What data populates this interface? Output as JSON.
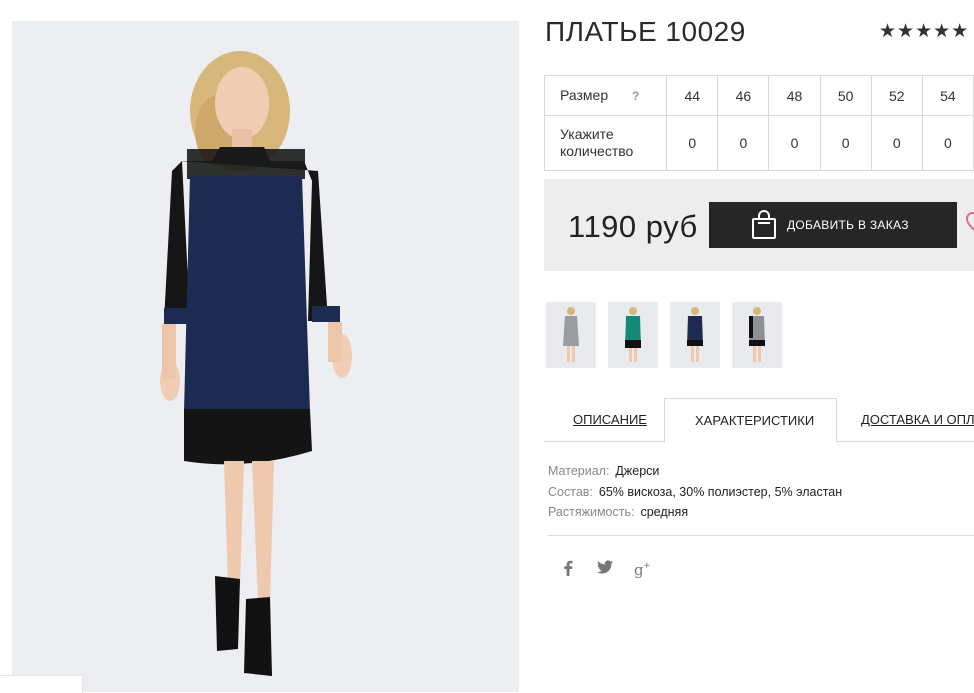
{
  "product": {
    "title": "ПЛАТЬЕ 10029",
    "rating": "★★★★★",
    "price": "1190 руб"
  },
  "sizes": {
    "size_label": "Размер",
    "help": "?",
    "qty_label_line1": "Укажите",
    "qty_label_line2": "количество",
    "values": [
      "44",
      "46",
      "48",
      "50",
      "52",
      "54"
    ],
    "quantities": [
      "0",
      "0",
      "0",
      "0",
      "0",
      "0"
    ]
  },
  "order": {
    "add_button": "ДОБАВИТЬ В ЗАКАЗ"
  },
  "thumbnails": [
    "grey-dress-thumb",
    "green-dress-thumb",
    "navy-dress-thumb",
    "grey-black-dress-thumb"
  ],
  "tabs": [
    {
      "label": "ОПИСАНИЕ",
      "active": false
    },
    {
      "label": "ХАРАКТЕРИСТИКИ",
      "active": true
    },
    {
      "label": "ДОСТАВКА И ОПЛАТА",
      "active": false
    }
  ],
  "specs": [
    {
      "key": "Материал:",
      "value": "Джерси"
    },
    {
      "key": "Состав:",
      "value": "65% вискоза, 30% полиэстер, 5% эластан"
    },
    {
      "key": "Растяжимость:",
      "value": "средняя"
    }
  ],
  "social": {
    "facebook": "f",
    "twitter": "🐦",
    "google_plus": "g+"
  },
  "colors": {
    "button_bg": "#262626",
    "order_box_bg": "#ededed",
    "dress_navy": "#1d2a52",
    "heart_pink": "#e0708a"
  },
  "icons": [
    "shopping-bag-icon",
    "heart-icon",
    "facebook-icon",
    "twitter-icon",
    "google-plus-icon"
  ]
}
